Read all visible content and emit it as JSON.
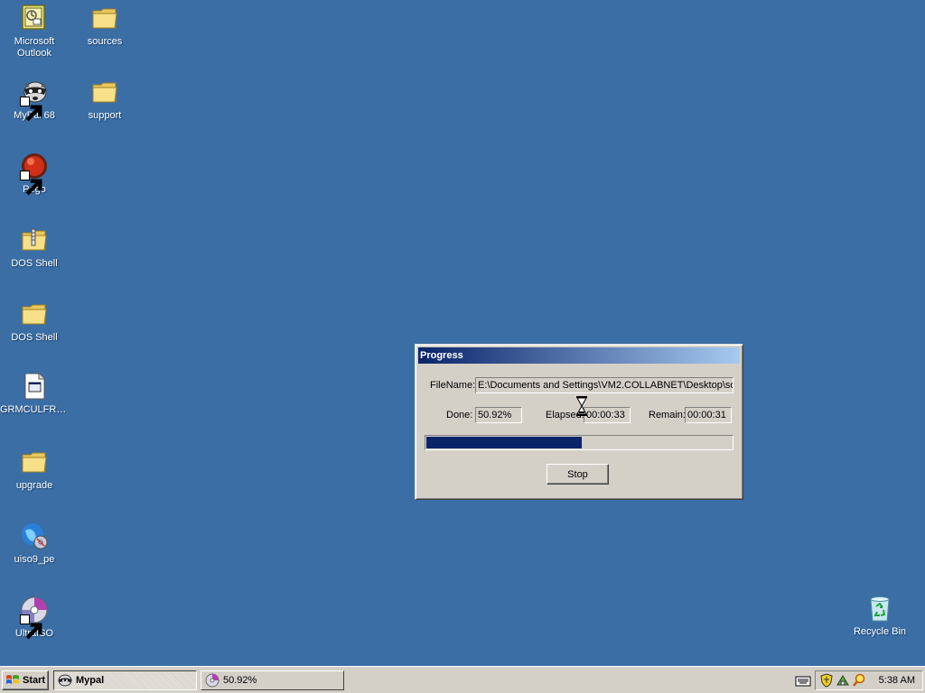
{
  "desktop": {
    "icons": [
      {
        "label": "Microsoft Outlook",
        "icon": "outlook-icon"
      },
      {
        "label": "sources",
        "icon": "folder-icon"
      },
      {
        "label": "MyPal 68",
        "icon": "raccoon-icon"
      },
      {
        "label": "support",
        "icon": "folder-icon"
      },
      {
        "label": "Pego",
        "icon": "red-ball-icon"
      },
      {
        "label": "DOS Shell",
        "icon": "zip-folder-icon"
      },
      {
        "label": "DOS Shell",
        "icon": "folder-icon"
      },
      {
        "label": "GRMCULFRE...",
        "icon": "exe-file-icon"
      },
      {
        "label": "upgrade",
        "icon": "folder-icon"
      },
      {
        "label": "uiso9_pe",
        "icon": "globe-disc-icon"
      },
      {
        "label": "UltraISO",
        "icon": "disc-icon"
      },
      {
        "label": "Recycle Bin",
        "icon": "recycle-bin-icon"
      }
    ]
  },
  "dialog": {
    "title": "Progress",
    "filename_label": "FileName:",
    "filename_value": "E:\\Documents and Settings\\VM2.COLLABNET\\Desktop\\so",
    "done_label": "Done:",
    "done_value": "50.92%",
    "elapsed_label": "Elapsed:",
    "elapsed_value": "00:00:33",
    "remain_label": "Remain:",
    "remain_value": "00:00:31",
    "progress_fraction": 0.5092,
    "stop_label": "Stop"
  },
  "taskbar": {
    "start_label": "Start",
    "tasks": [
      {
        "label": "Mypal",
        "icon": "raccoon-icon",
        "active": true
      },
      {
        "label": "50.92%",
        "icon": "disc-icon",
        "active": false
      }
    ],
    "clock": "5:38 AM"
  },
  "colors": {
    "desktop_bg": "#3a6ea5",
    "title_gradient_start": "#0a246a",
    "title_gradient_end": "#a6caf0",
    "progress_fill": "#0a246a"
  }
}
